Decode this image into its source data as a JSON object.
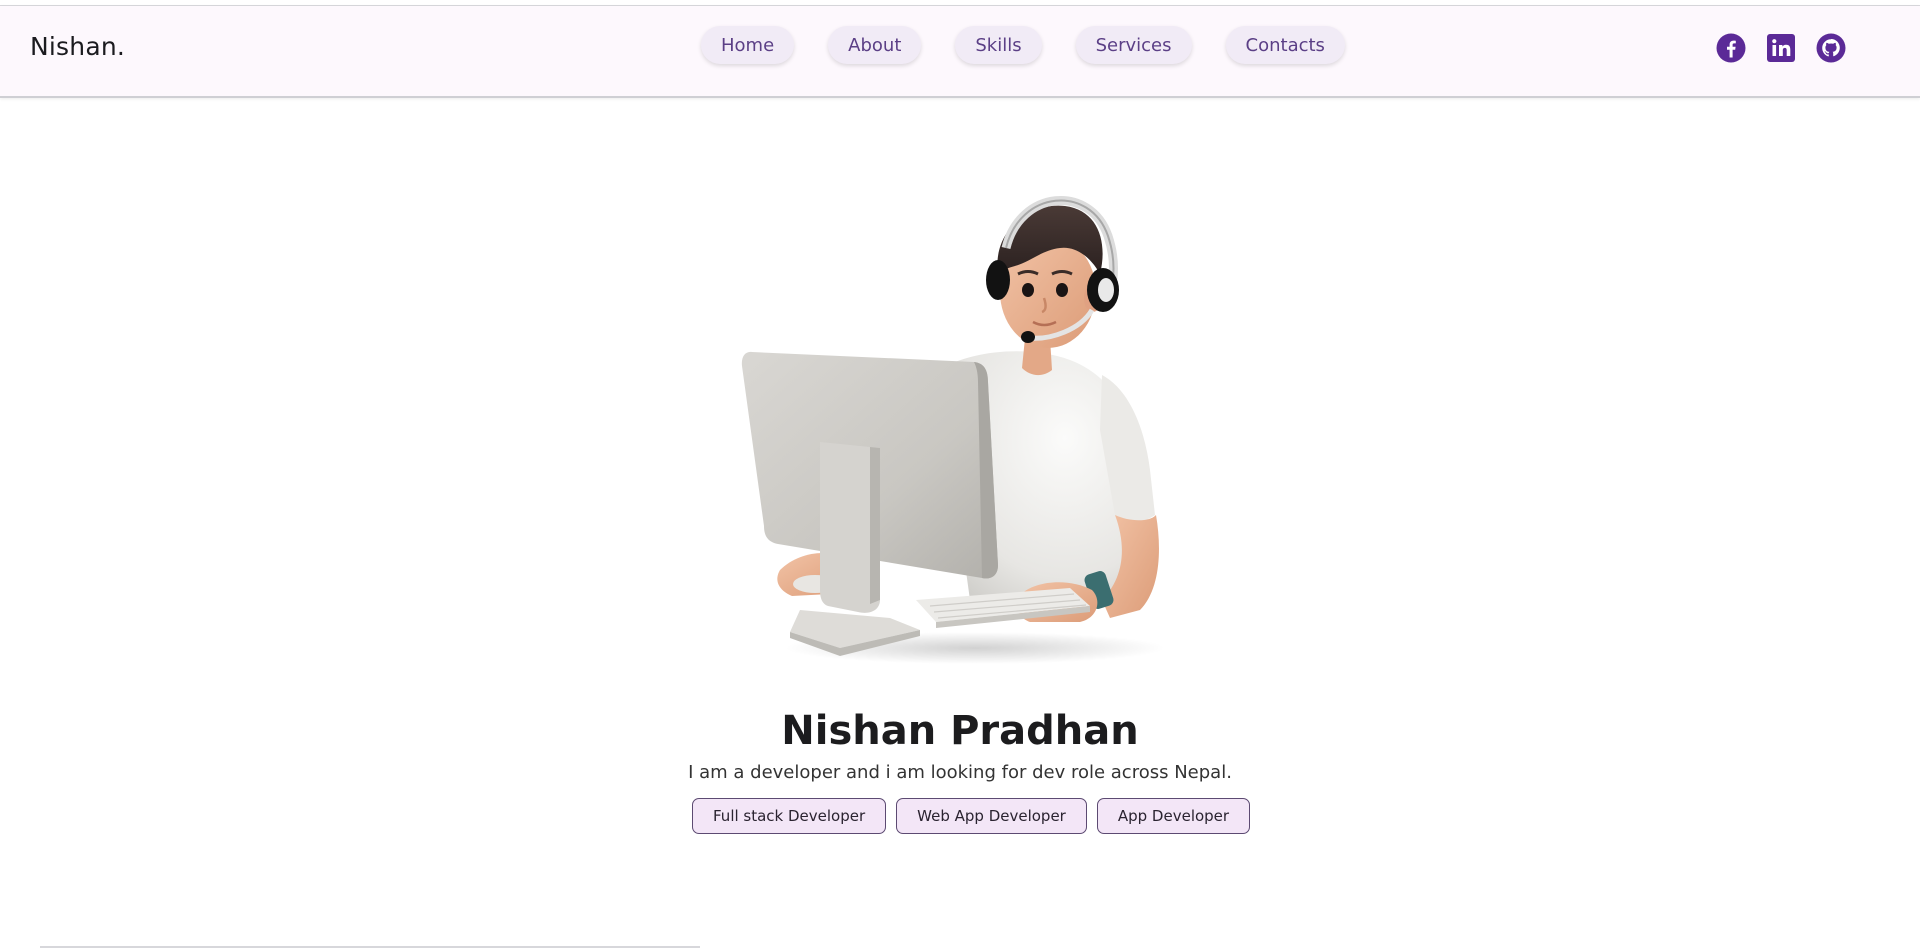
{
  "header": {
    "brand": "Nishan.",
    "nav": [
      {
        "label": "Home"
      },
      {
        "label": "About"
      },
      {
        "label": "Skills"
      },
      {
        "label": "Services"
      },
      {
        "label": "Contacts"
      }
    ],
    "socials": [
      {
        "icon": "facebook-icon"
      },
      {
        "icon": "linkedin-icon"
      },
      {
        "icon": "github-icon"
      }
    ]
  },
  "hero": {
    "name": "Nishan Pradhan",
    "tagline": "I am a developer and i am looking for dev role across Nepal.",
    "roles": [
      {
        "label": "Full stack Developer"
      },
      {
        "label": "Web App Developer"
      },
      {
        "label": "App Developer"
      }
    ]
  },
  "colors": {
    "accent": "#5b2a97",
    "nav_text": "#5b3f86",
    "nav_bg": "#f1ebf6",
    "role_bg": "#f3e6f7",
    "header_bg": "#fdf8fd"
  }
}
